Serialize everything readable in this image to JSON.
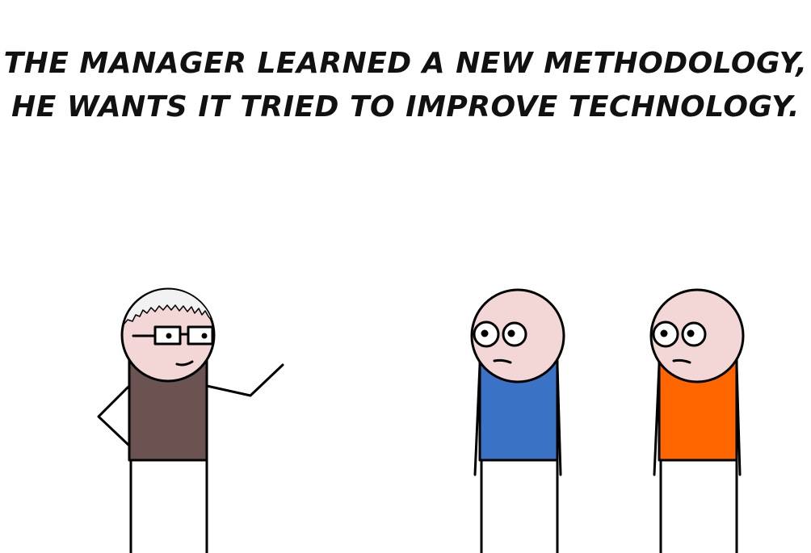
{
  "caption": {
    "line1": "THE MANAGER LEARNED A NEW METHODOLOGY,",
    "line2": "HE WANTS IT TRIED TO IMPROVE TECHNOLOGY."
  },
  "colors": {
    "skin": "#f3d7d7",
    "manager_shirt": "#6b5351",
    "dev1_shirt": "#3a73c6",
    "dev2_shirt": "#ff6600",
    "hair": "#f2f2f2",
    "line": "#000000"
  }
}
